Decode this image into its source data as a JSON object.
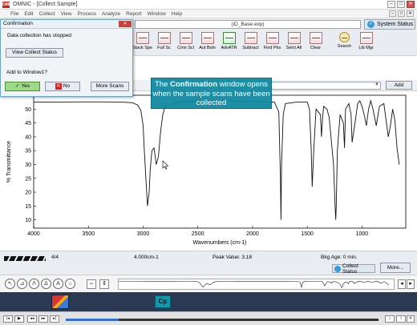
{
  "window": {
    "title": "OMNIC - [Collect Sample]",
    "logo": "OMNIC"
  },
  "menu": [
    "File",
    "Edit",
    "Collect",
    "View",
    "Process",
    "Analyze",
    "Report",
    "Window",
    "Help"
  ],
  "toolbar": {
    "file_name": "(iD_Base.exp)",
    "system_status": "System Status",
    "tools": [
      "Stack Spe",
      "Full Sc",
      "Cmn Scl",
      "Aut Bsln",
      "AdvATR",
      "Subtract",
      "Find Pks",
      "Selct All",
      "Clear",
      "Search",
      "Lib Mgr"
    ],
    "partial_tool": "int"
  },
  "add_bar": {
    "add_label": "Add"
  },
  "dialog": {
    "title": "Confirmation",
    "message": "Data collection has stopped.",
    "view_button": "View Collect Status",
    "prompt": "Add to Window1?",
    "yes": "Yes",
    "no": "No",
    "more_scans": "More Scans"
  },
  "callout": {
    "bold": "Confirmation",
    "pre": "The ",
    "post": " window opens when the sample scans have been collected"
  },
  "chart_data": {
    "type": "line",
    "xlabel": "Wavenumbers (cm-1)",
    "ylabel": "% Transmittance",
    "xlim": [
      4000,
      600
    ],
    "ylim": [
      7,
      55
    ],
    "x_ticks": [
      4000,
      3500,
      3000,
      2500,
      2000,
      1500,
      1000
    ],
    "y_ticks": [
      10,
      15,
      20,
      25,
      30,
      35,
      40,
      45,
      50
    ],
    "series": [
      {
        "x": [
          4000,
          3800,
          3600,
          3400,
          3200,
          3100,
          3050,
          3020,
          3000,
          2990,
          2975,
          2960,
          2945,
          2935,
          2920,
          2900,
          2880,
          2860,
          2840,
          2820,
          2800,
          2700,
          2500,
          2300,
          2000,
          1800,
          1760,
          1745,
          1740,
          1735,
          1720,
          1700,
          1600,
          1500,
          1480,
          1465,
          1455,
          1440,
          1420,
          1380,
          1370,
          1360,
          1350,
          1320,
          1300,
          1260,
          1245,
          1240,
          1235,
          1225,
          1200,
          1170,
          1160,
          1150,
          1120,
          1100,
          1090,
          1060,
          1040,
          1020,
          1000,
          980,
          960,
          940,
          920,
          900,
          870,
          840,
          800,
          780,
          760,
          740,
          720,
          700,
          680,
          660
        ],
        "y": [
          52.5,
          52.5,
          52.6,
          52.6,
          52.5,
          52.3,
          51.5,
          49.5,
          44,
          36,
          25,
          15,
          20,
          28,
          35,
          36,
          30,
          33,
          42,
          48,
          51,
          52.3,
          53,
          53,
          52.8,
          52.5,
          49,
          25,
          10,
          30,
          48,
          52,
          52.5,
          52.5,
          50,
          36,
          22,
          36,
          50,
          48,
          40,
          47,
          51,
          50,
          47,
          30,
          14,
          10,
          15,
          35,
          48,
          45,
          36,
          50,
          52,
          48,
          38,
          46,
          52,
          53,
          51,
          48,
          44,
          50,
          53,
          50,
          44,
          51,
          52,
          46,
          40,
          44,
          50,
          46,
          36,
          30
        ]
      }
    ]
  },
  "status": {
    "scan_count": "4/4",
    "resolution": "4.000cm-1",
    "peak_value": "Peak Value: 3.18",
    "bkg_age": "Bkg Age: 0 min.",
    "collect_status": "Collect Status",
    "more": "More..."
  },
  "taskbar": {
    "cp_label": "Cp"
  },
  "player": {
    "progress": 0.17
  }
}
